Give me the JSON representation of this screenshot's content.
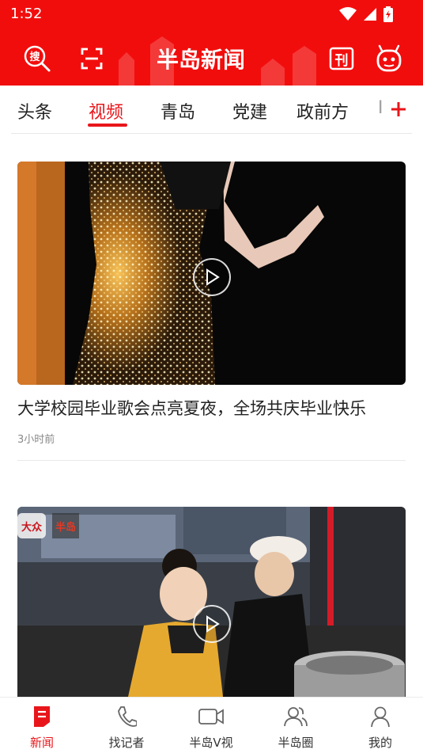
{
  "status_bar": {
    "time": "1:52"
  },
  "header": {
    "logo_text": "半岛新闻",
    "search_label": "搜",
    "paper_label": "刊"
  },
  "tabs": [
    {
      "label": "头条"
    },
    {
      "label": "视频"
    },
    {
      "label": "青岛"
    },
    {
      "label": "党建"
    },
    {
      "label": "政前方"
    },
    {
      "label": "I"
    }
  ],
  "feed": [
    {
      "title": "大学校园毕业歌会点亮夏夜，全场共庆毕业快乐",
      "time": "3小时前"
    },
    {
      "title": "",
      "time": "",
      "badge_text": "大众",
      "badge_text2": "半岛"
    }
  ],
  "bottom_nav": [
    {
      "label": "新闻"
    },
    {
      "label": "找记者"
    },
    {
      "label": "半岛V视"
    },
    {
      "label": "半岛圈"
    },
    {
      "label": "我的"
    }
  ],
  "colors": {
    "brand_red": "#e8161b",
    "header_red": "#f20d0d"
  }
}
